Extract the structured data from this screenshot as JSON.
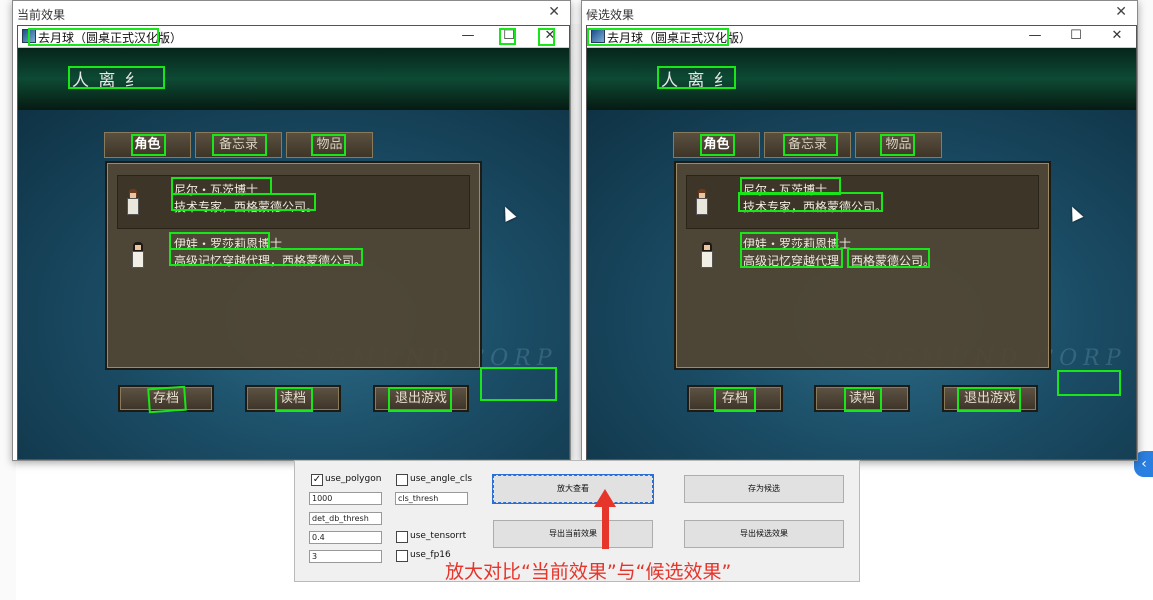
{
  "windows": {
    "current": {
      "title": "当前效果",
      "close": "✕",
      "game": {
        "title": "去月球（圆桌正式汉化版）",
        "minimize": "—",
        "maximize": "☐",
        "close": "✕",
        "banner": "人 离 纟",
        "watermark": "SIGMUND CORP",
        "tabs": [
          "角色",
          "备忘录",
          "物品"
        ],
        "characters": [
          {
            "name": "尼尔・瓦茨博士",
            "desc": "技术专家，西格蒙德公司。"
          },
          {
            "name": "伊娃・罗莎莉恩博士",
            "desc": "高级记忆穿越代理，西格蒙德公司。"
          }
        ],
        "buttons": [
          "存档",
          "读档",
          "退出游戏"
        ]
      }
    },
    "candidate": {
      "title": "候选效果",
      "close": "✕",
      "game": {
        "title": "去月球（圆桌正式汉化版）",
        "minimize": "—",
        "maximize": "☐",
        "close": "✕",
        "banner": "人 离 纟",
        "watermark": "SIGMUND CORP",
        "tabs": [
          "角色",
          "备忘录",
          "物品"
        ],
        "characters": [
          {
            "name": "尼尔・瓦茨博士",
            "desc": "技术专家，西格蒙德公司。"
          },
          {
            "name": "伊娃・罗莎莉恩博士",
            "desc_a": "高级记忆穿越代理，",
            "desc_b": "西格蒙德公司。"
          }
        ],
        "buttons": [
          "存档",
          "读档",
          "退出游戏"
        ]
      }
    }
  },
  "panel": {
    "use_polygon": {
      "label": "use_polygon",
      "checked": true,
      "mark": "✓"
    },
    "use_angle_cls": {
      "label": "use_angle_cls",
      "checked": false
    },
    "field1": "1000",
    "cls_thresh": "cls_thresh",
    "det_db_thresh": "det_db_thresh",
    "field3": "0.4",
    "use_tensorrt": {
      "label": "use_tensorrt",
      "checked": false
    },
    "field4": "3",
    "use_fp16": {
      "label": "use_fp16",
      "checked": false
    },
    "btn_zoom": "放大查看",
    "btn_save_candidate": "存为候选",
    "btn_export_current": "导出当前效果",
    "btn_export_candidate": "导出候选效果"
  },
  "annotation": "放大对比“当前效果”与“候选效果”",
  "colors": {
    "box": "#19e619",
    "annotation": "#e6352b"
  }
}
